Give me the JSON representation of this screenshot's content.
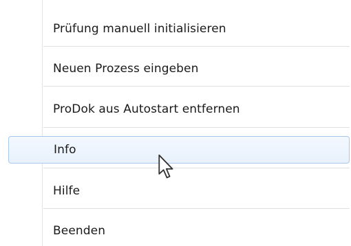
{
  "menu": {
    "items": [
      {
        "label": "Prüfung manuell initialisieren"
      },
      {
        "label": "Neuen Prozess eingeben"
      },
      {
        "label": "ProDok aus Autostart entfernen"
      },
      {
        "label": "Info",
        "highlighted": true
      },
      {
        "label": "Hilfe"
      },
      {
        "label": "Beenden"
      }
    ]
  },
  "cursor": {
    "icon": "arrow-pointer-icon"
  },
  "colors": {
    "highlight_border": "#a9c7ee",
    "highlight_fill": "#eaf2fd",
    "separator": "#e0e0e0",
    "text": "#1a1a1a"
  }
}
